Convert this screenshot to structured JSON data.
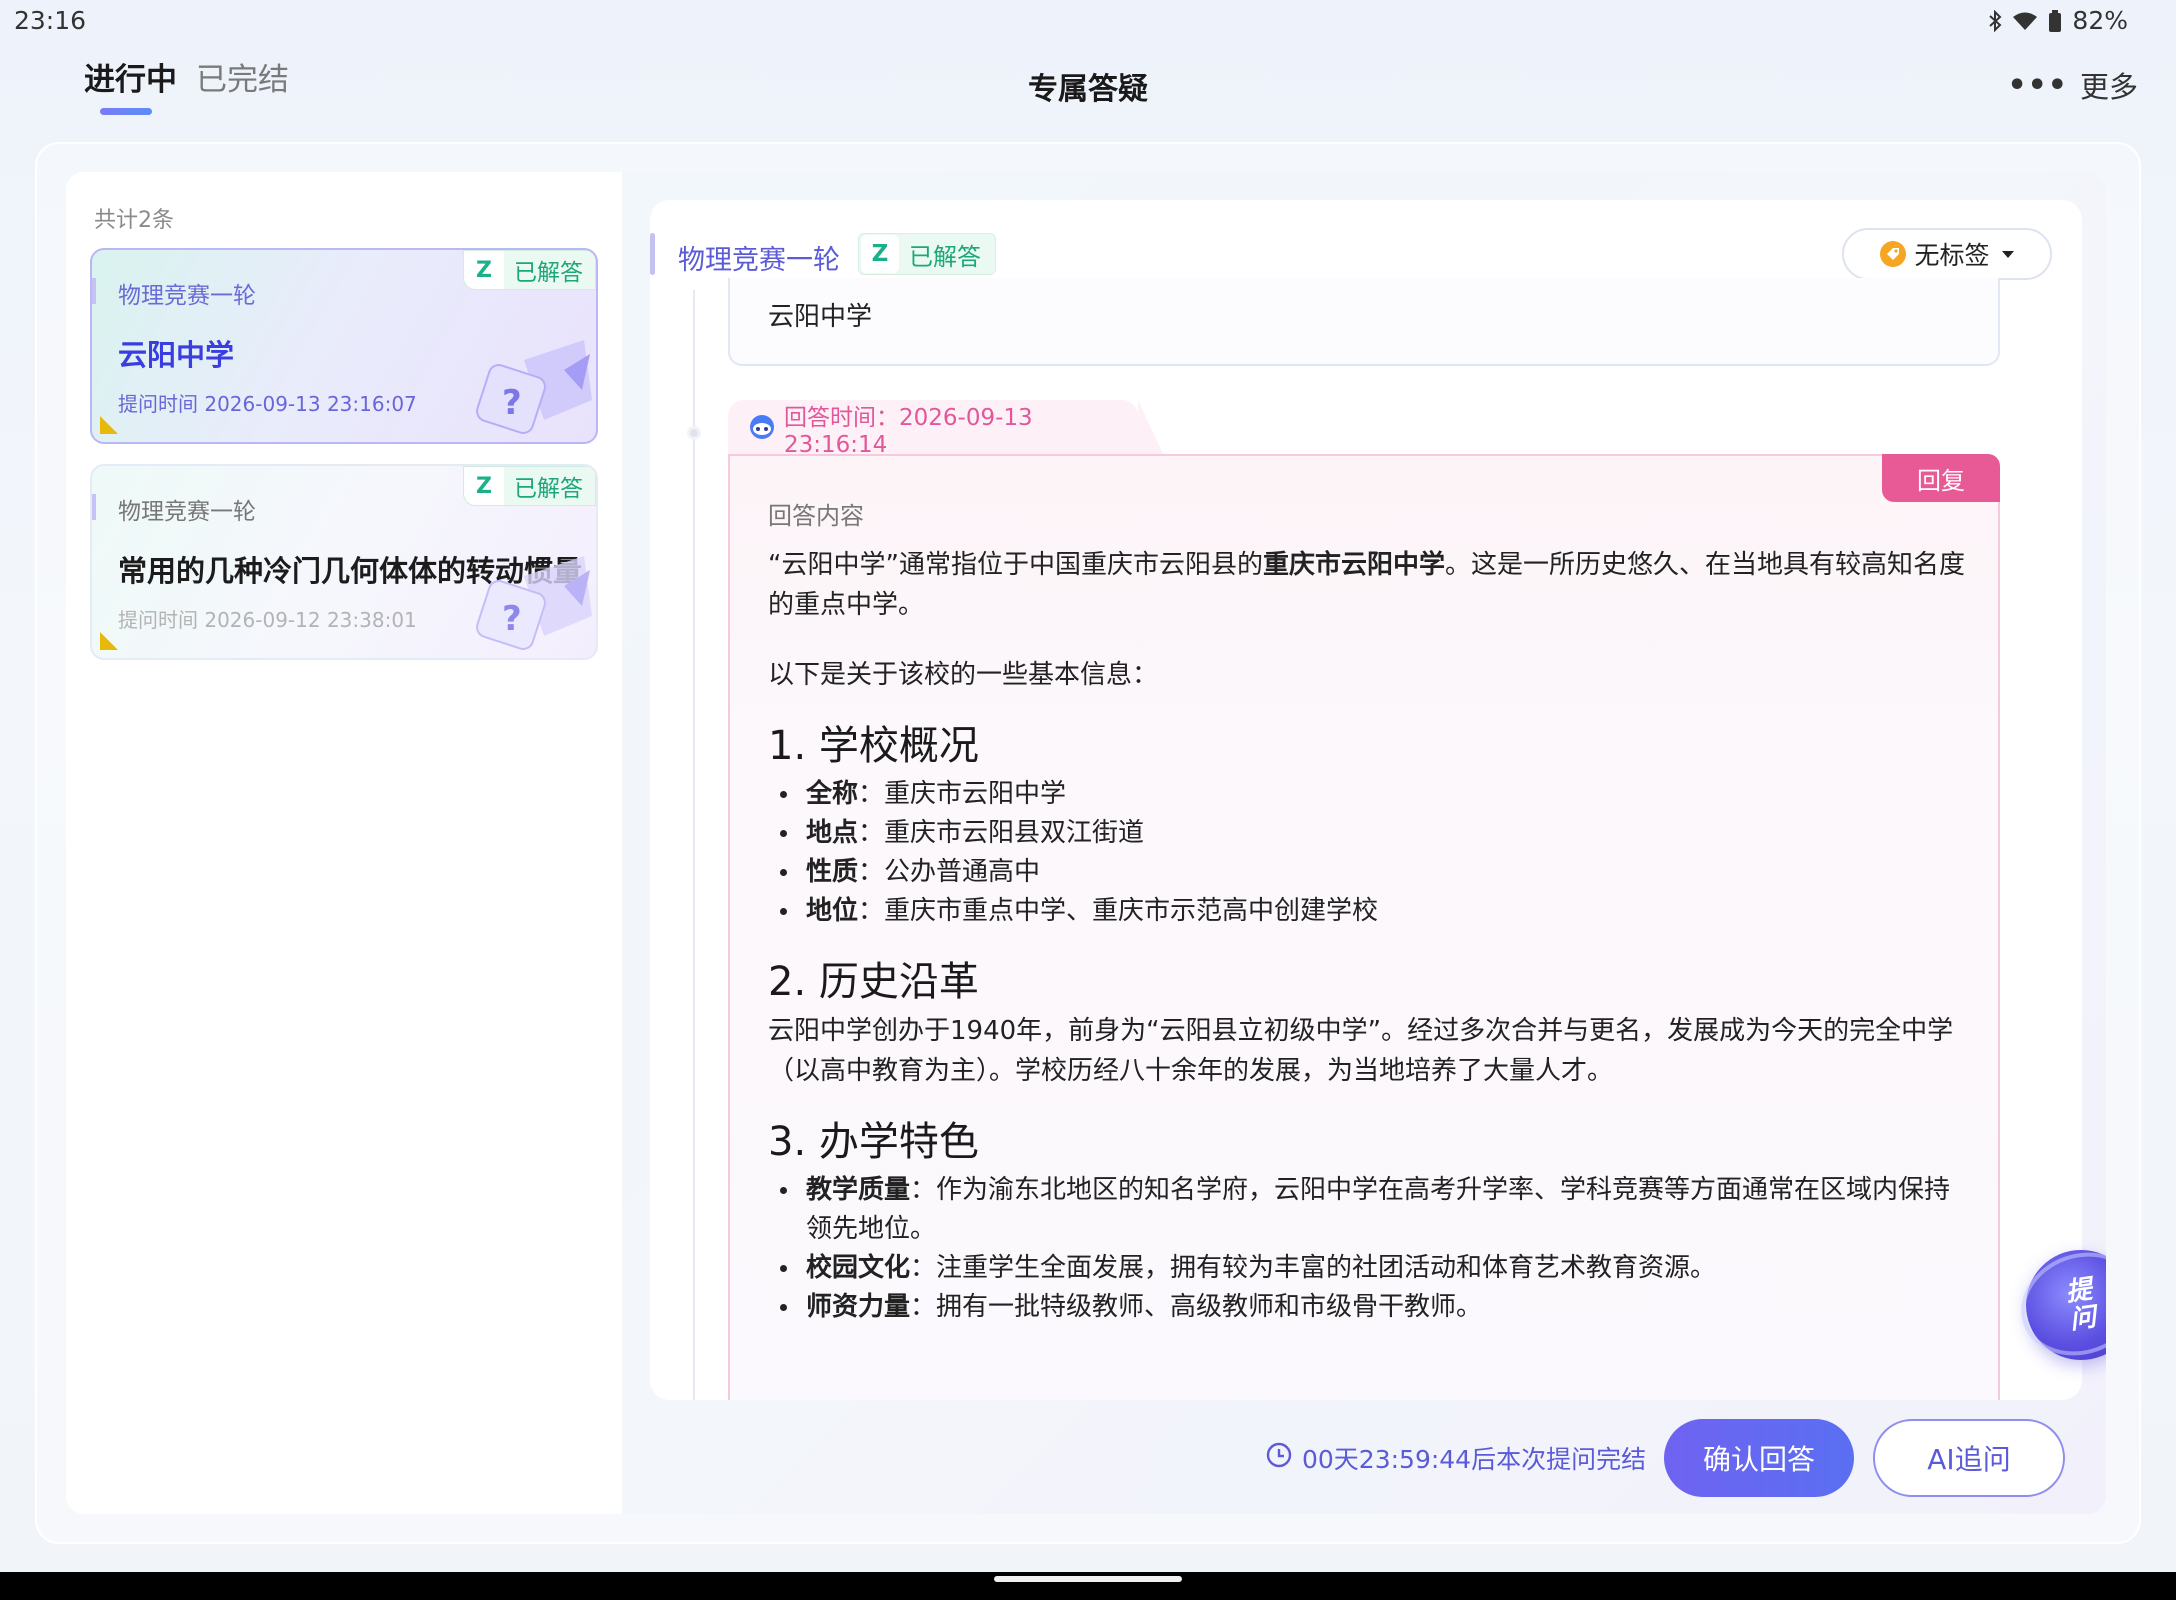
{
  "status_bar": {
    "time": "23:16",
    "battery": "82%"
  },
  "header": {
    "tabs": [
      {
        "label": "进行中"
      },
      {
        "label": "已完结"
      }
    ],
    "title": "专属答疑",
    "more_label": "更多"
  },
  "sidebar": {
    "count_text": "共计2条",
    "cards": [
      {
        "subject": "物理竞赛一轮",
        "title": "云阳中学",
        "time": "提问时间 2026-09-13 23:16:07",
        "badge_icon": "Z",
        "badge": "已解答"
      },
      {
        "subject": "物理竞赛一轮",
        "title": "常用的几种冷门几何体体的转动惯量",
        "time": "提问时间 2026-09-12 23:38:01",
        "badge_icon": "Z",
        "badge": "已解答"
      }
    ]
  },
  "detail": {
    "subject": "物理竞赛一轮",
    "badge_icon": "Z",
    "badge": "已解答",
    "tag_label": "无标签",
    "question_text": "云阳中学",
    "answer_time": "回答时间：2026-09-13 23:16:14",
    "reply_label": "回复",
    "answer_label": "回答内容",
    "intro_pre": "“云阳中学”通常指位于中国重庆市云阳县的",
    "intro_bold": "重庆市云阳中学",
    "intro_post": "。这是一所历史悠久、在当地具有较高知名度的重点中学。",
    "basic_info": "以下是关于该校的一些基本信息：",
    "sections": [
      {
        "heading": "1. 学校概况",
        "items": [
          {
            "key": "全称",
            "value": "：重庆市云阳中学"
          },
          {
            "key": "地点",
            "value": "：重庆市云阳县双江街道"
          },
          {
            "key": "性质",
            "value": "：公办普通高中"
          },
          {
            "key": "地位",
            "value": "：重庆市重点中学、重庆市示范高中创建学校"
          }
        ]
      },
      {
        "heading": "2. 历史沿革",
        "paragraph": "云阳中学创办于1940年，前身为“云阳县立初级中学”。经过多次合并与更名，发展成为今天的完全中学（以高中教育为主）。学校历经八十余年的发展，为当地培养了大量人才。"
      },
      {
        "heading": "3. 办学特色",
        "items": [
          {
            "key": "教学质量",
            "value": "：作为渝东北地区的知名学府，云阳中学在高考升学率、学科竞赛等方面通常在区域内保持领先地位。"
          },
          {
            "key": "校园文化",
            "value": "：注重学生全面发展，拥有较为丰富的社团活动和体育艺术教育资源。"
          },
          {
            "key": "师资力量",
            "value": "：拥有一批特级教师、高级教师和市级骨干教师。"
          }
        ]
      }
    ],
    "float_ask_label": "提问"
  },
  "footer": {
    "countdown": "00天23:59:44后本次提问完结",
    "confirm_label": "确认回答",
    "ai_label": "AI追问"
  },
  "colors": {
    "accent": "#5b5bd8",
    "answered_green": "#1ea77a",
    "answer_pink": "#e85a95"
  }
}
